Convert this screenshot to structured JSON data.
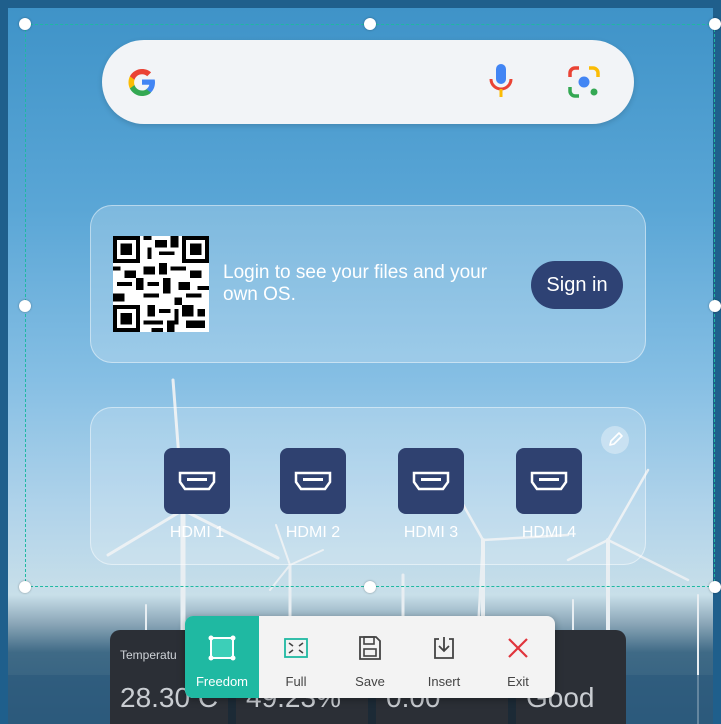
{
  "search": {
    "google_icon": "google-g-icon",
    "mic_icon": "microphone-icon",
    "lens_icon": "google-lens-icon"
  },
  "login": {
    "message": "Login to see your files and your own OS.",
    "sign_in_label": "Sign in"
  },
  "sources": {
    "edit_icon": "pencil-icon",
    "items": [
      {
        "label": "HDMI 1",
        "icon": "hdmi-icon"
      },
      {
        "label": "HDMI 2",
        "icon": "hdmi-icon"
      },
      {
        "label": "HDMI 3",
        "icon": "hdmi-icon"
      },
      {
        "label": "HDMI 4",
        "icon": "hdmi-icon"
      }
    ]
  },
  "weather": {
    "temperature_label": "Temperatu",
    "temperature_value": "28.30 C",
    "humidity_value": "49.23%",
    "third_value": "0.00",
    "air_quality_value": "Good"
  },
  "toolbar": {
    "items": [
      {
        "label": "Freedom",
        "icon": "freedom-select-icon",
        "active": true
      },
      {
        "label": "Full",
        "icon": "full-screen-icon",
        "active": false
      },
      {
        "label": "Save",
        "icon": "save-icon",
        "active": false
      },
      {
        "label": "Insert",
        "icon": "insert-icon",
        "active": false
      },
      {
        "label": "Exit",
        "icon": "close-icon",
        "active": false
      }
    ]
  },
  "colors": {
    "accent": "#1fb9a2",
    "button_navy": "#2e4274",
    "exit_red": "#e0343c"
  }
}
